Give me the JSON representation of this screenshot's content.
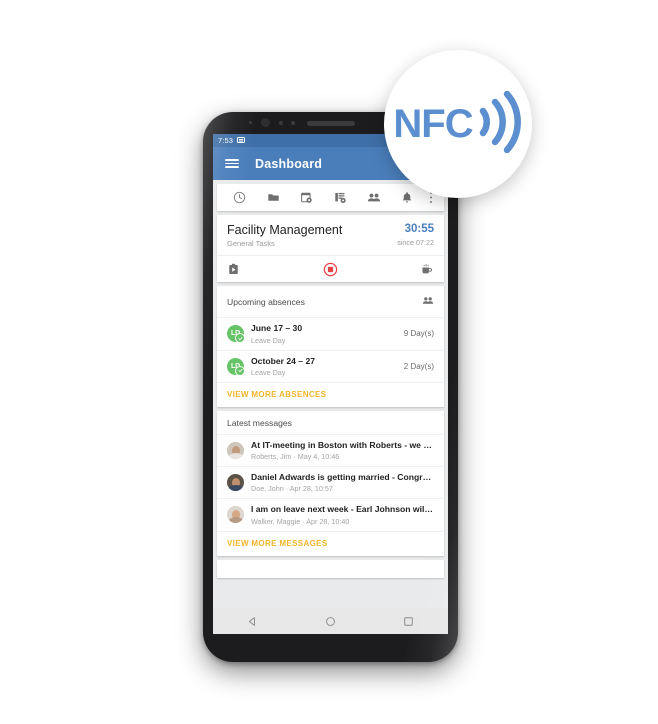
{
  "badge": {
    "label": "NFC",
    "icon": "nfc-wave-icon",
    "color": "#5b8fd0"
  },
  "phone": {
    "statusbar": {
      "time": "7:53",
      "icons": [
        "sim-card-icon",
        "vpn-key-icon"
      ]
    },
    "appbar": {
      "menu_icon": "hamburger-menu-icon",
      "title": "Dashboard",
      "color": "#4a7ebb"
    },
    "toolbar": {
      "items": [
        {
          "icon": "clock-icon",
          "name": "time-tracking"
        },
        {
          "icon": "folder-icon",
          "name": "projects"
        },
        {
          "icon": "calendar-settings-icon",
          "name": "calendar"
        },
        {
          "icon": "report-settings-icon",
          "name": "reports"
        },
        {
          "icon": "people-icon",
          "name": "team"
        },
        {
          "icon": "bell-icon",
          "name": "notifications"
        },
        {
          "icon": "overflow-menu-icon",
          "name": "more-options"
        }
      ]
    },
    "timer": {
      "title": "Facility Management",
      "subtitle": "General Tasks",
      "value": "30:55",
      "since": "since 07:22",
      "value_color": "#4a7ebb",
      "actions": [
        {
          "icon": "task-switch-icon",
          "name": "switch-task"
        },
        {
          "icon": "stop-record-icon",
          "name": "stop-timer",
          "color": "#e8433f"
        },
        {
          "icon": "coffee-cup-icon",
          "name": "take-break"
        }
      ]
    },
    "absences": {
      "header": "Upcoming absences",
      "header_icon": "people-icon",
      "items": [
        {
          "badge": "LD",
          "title": "June 17 – 30",
          "subtitle": "Leave Day",
          "right": "9 Day(s)"
        },
        {
          "badge": "LD",
          "title": "October 24 – 27",
          "subtitle": "Leave Day",
          "right": "2 Day(s)"
        }
      ],
      "more_label": "VIEW MORE ABSENCES",
      "badge_color": "#67c368",
      "link_color": "#f0b429"
    },
    "messages": {
      "header": "Latest messages",
      "items": [
        {
          "title": "At IT-meeting in Boston with Roberts - we ca…",
          "subtitle": "Roberts, Jim · May 4, 10:46"
        },
        {
          "title": "Daniel Adwards is getting married - Congrat…",
          "subtitle": "Doe, John · Apr 28, 10:57"
        },
        {
          "title": "I am on leave next week  - Earl Johnson will c…",
          "subtitle": "Walker, Maggie · Apr 28, 10:40"
        }
      ],
      "more_label": "VIEW MORE MESSAGES"
    },
    "navbar": {
      "items": [
        {
          "icon": "back-triangle-icon",
          "name": "android-back"
        },
        {
          "icon": "home-circle-icon",
          "name": "android-home"
        },
        {
          "icon": "recents-square-icon",
          "name": "android-recents"
        }
      ]
    }
  }
}
